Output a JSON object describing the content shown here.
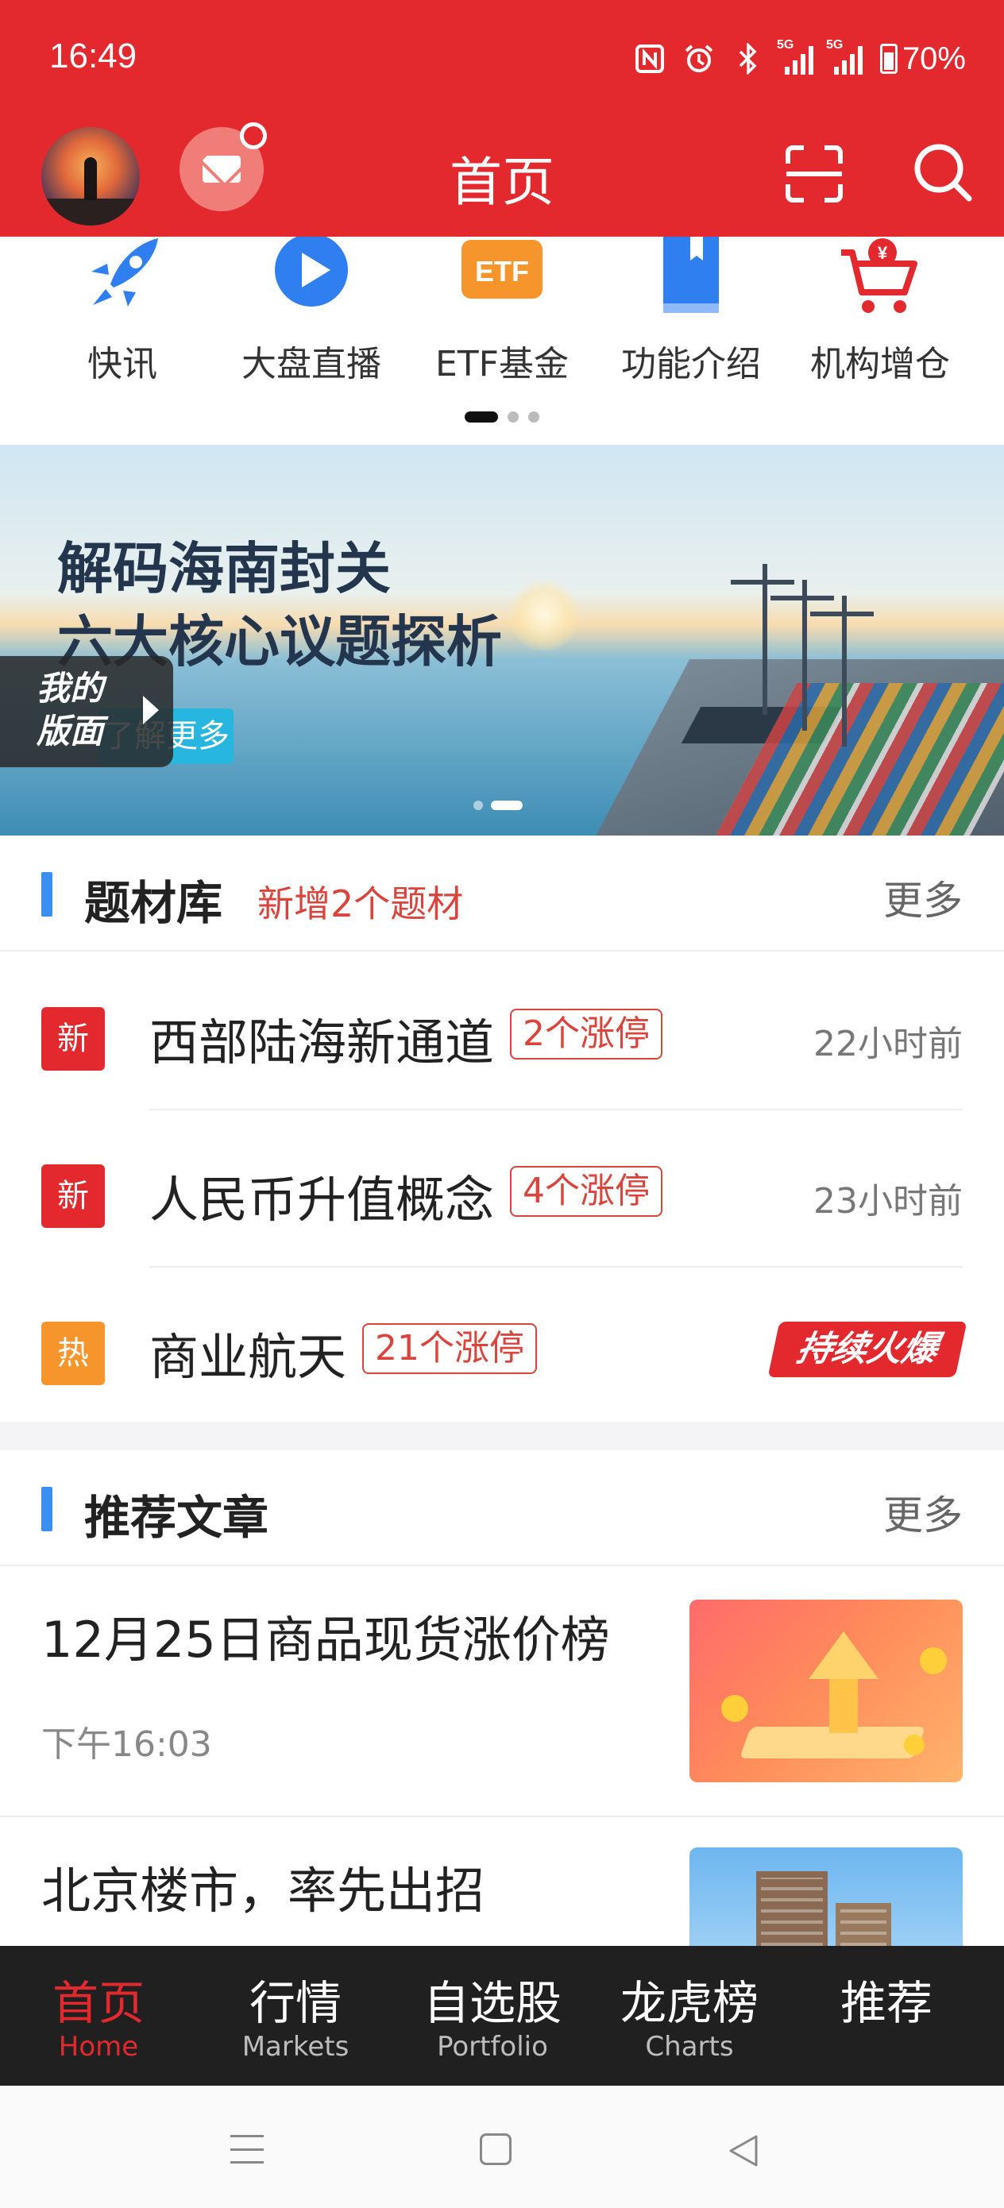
{
  "status": {
    "time": "16:49",
    "battery": "70%",
    "signal1": "5G",
    "signal2": "5G"
  },
  "header": {
    "title": "首页"
  },
  "quick_menu": [
    {
      "label": "快讯",
      "icon": "rocket-icon"
    },
    {
      "label": "大盘直播",
      "icon": "play-icon"
    },
    {
      "label": "ETF基金",
      "icon": "etf-icon"
    },
    {
      "label": "功能介绍",
      "icon": "book-icon"
    },
    {
      "label": "机构增仓",
      "icon": "cart-icon"
    }
  ],
  "etf_icon_text": "ETF",
  "banner": {
    "line1": "解码海南封关",
    "line2": "六大核心议题探析",
    "button": "了解更多",
    "my_layout_line1": "我的",
    "my_layout_line2": "版面"
  },
  "topics": {
    "title": "题材库",
    "subtitle": "新增2个题材",
    "more": "更多",
    "rows": [
      {
        "tag": "新",
        "tag_type": "new",
        "name": "西部陆海新通道",
        "limit_up": "2个涨停",
        "time": "22小时前"
      },
      {
        "tag": "新",
        "tag_type": "new",
        "name": "人民币升值概念",
        "limit_up": "4个涨停",
        "time": "23小时前"
      },
      {
        "tag": "热",
        "tag_type": "hot",
        "name": "商业航天",
        "limit_up": "21个涨停",
        "badge": "持续火爆"
      }
    ]
  },
  "articles": {
    "title": "推荐文章",
    "more": "更多",
    "items": [
      {
        "title": "12月25日商品现货涨价榜",
        "time": "下午16:03"
      },
      {
        "title": "北京楼市，率先出招"
      }
    ]
  },
  "bottom_nav": [
    {
      "cn": "首页",
      "en": "Home",
      "active": true
    },
    {
      "cn": "行情",
      "en": "Markets"
    },
    {
      "cn": "自选股",
      "en": "Portfolio"
    },
    {
      "cn": "龙虎榜",
      "en": "Charts"
    },
    {
      "cn": "推荐",
      "en": ""
    }
  ],
  "colors": {
    "brand_red": "#e3292e",
    "accent_blue": "#3a8ff0",
    "hot_orange": "#f5952b"
  }
}
